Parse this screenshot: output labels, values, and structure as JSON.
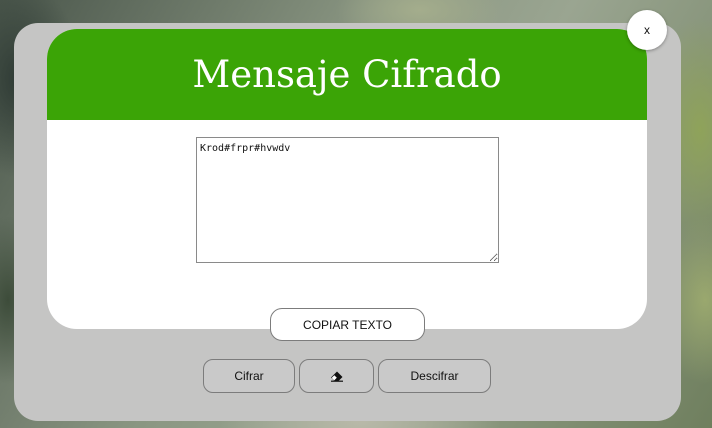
{
  "modal": {
    "title": "Mensaje Cifrado",
    "message_value": "Krod#frpr#hvwdv",
    "copy_label": "COPIAR TEXTO",
    "close_label": "x"
  },
  "actions": {
    "encrypt_label": "Cifrar",
    "erase_icon": "eraser-icon",
    "decrypt_label": "Descifrar"
  },
  "colors": {
    "header": "#3ba406",
    "modal_bg": "#c5c5c4",
    "button_bg": "#c9c9c9"
  }
}
